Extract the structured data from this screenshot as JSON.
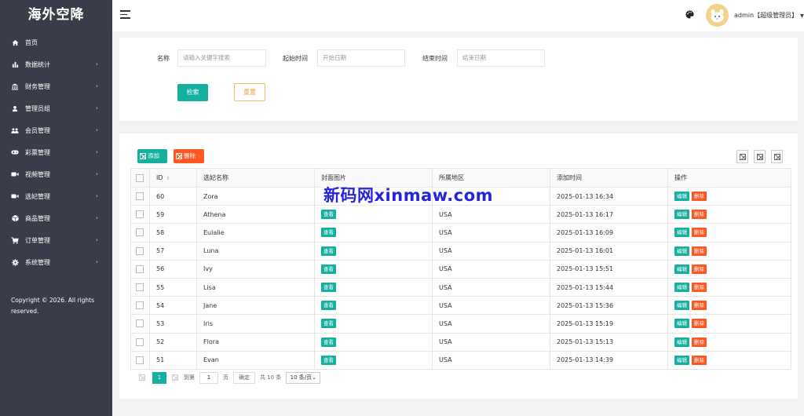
{
  "app": {
    "title": "海外空降"
  },
  "sidebar": {
    "items": [
      {
        "label": "首页",
        "icon": "home-icon",
        "arrow": ""
      },
      {
        "label": "数据统计",
        "icon": "bar-chart-icon",
        "arrow": "›"
      },
      {
        "label": "财务管理",
        "icon": "bank-icon",
        "arrow": "›"
      },
      {
        "label": "管理员组",
        "icon": "user-icon",
        "arrow": "›"
      },
      {
        "label": "会员管理",
        "icon": "users-icon",
        "arrow": "›"
      },
      {
        "label": "彩票管理",
        "icon": "gamepad-icon",
        "arrow": "›"
      },
      {
        "label": "视频管理",
        "icon": "video-icon",
        "arrow": "›"
      },
      {
        "label": "选妃管理",
        "icon": "camera-icon",
        "arrow": "›"
      },
      {
        "label": "商品管理",
        "icon": "cube-icon",
        "arrow": "›"
      },
      {
        "label": "订单管理",
        "icon": "cart-icon",
        "arrow": "›"
      },
      {
        "label": "系统管理",
        "icon": "gear-icon",
        "arrow": "›"
      }
    ],
    "copyright": "Copyright © 2026. All rights reserved."
  },
  "header": {
    "user": "admin【超级管理员】",
    "caret": "▼"
  },
  "search": {
    "name_label": "名称",
    "name_placeholder": "请输入关键字搜索",
    "start_label": "起始时间",
    "start_placeholder": "开始日期",
    "end_label": "结束时间",
    "end_placeholder": "结束日期",
    "search_button": "检索",
    "reset_button": "重置"
  },
  "toolbar": {
    "add_label": "添加",
    "delete_label": "删除"
  },
  "table": {
    "columns": [
      "ID",
      "选妃名称",
      "封面图片",
      "所属地区",
      "添加时间",
      "操作"
    ],
    "sort_icon": "⇕",
    "view_label": "查看",
    "edit_label": "编辑",
    "remove_label": "删除",
    "rows": [
      {
        "id": "60",
        "name": "Zora",
        "region": "",
        "time": "2025-01-13 16:34"
      },
      {
        "id": "59",
        "name": "Athena",
        "region": "USA",
        "time": "2025-01-13 16:17"
      },
      {
        "id": "58",
        "name": "Eulalie",
        "region": "USA",
        "time": "2025-01-13 16:09"
      },
      {
        "id": "57",
        "name": "Luna",
        "region": "USA",
        "time": "2025-01-13 16:01"
      },
      {
        "id": "56",
        "name": "Ivy",
        "region": "USA",
        "time": "2025-01-13 15:51"
      },
      {
        "id": "55",
        "name": "Lisa",
        "region": "USA",
        "time": "2025-01-13 15:44"
      },
      {
        "id": "54",
        "name": "Jane",
        "region": "USA",
        "time": "2025-01-13 15:36"
      },
      {
        "id": "53",
        "name": "Iris",
        "region": "USA",
        "time": "2025-01-13 15:19"
      },
      {
        "id": "52",
        "name": "Flora",
        "region": "USA",
        "time": "2025-01-13 15:13"
      },
      {
        "id": "51",
        "name": "Evan",
        "region": "USA",
        "time": "2025-01-13 14:39"
      }
    ]
  },
  "pagination": {
    "current": "1",
    "goto_label": "到第",
    "page_value": "1",
    "page_unit": "页",
    "confirm": "确定",
    "total": "共 10 条",
    "page_size": "10 条/页"
  },
  "watermark": "新码网xinmaw.com",
  "colors": {
    "sidebar": "#393d49",
    "primary": "#16b0a0",
    "danger": "#ff5722",
    "warning": "#f2bd6b"
  }
}
